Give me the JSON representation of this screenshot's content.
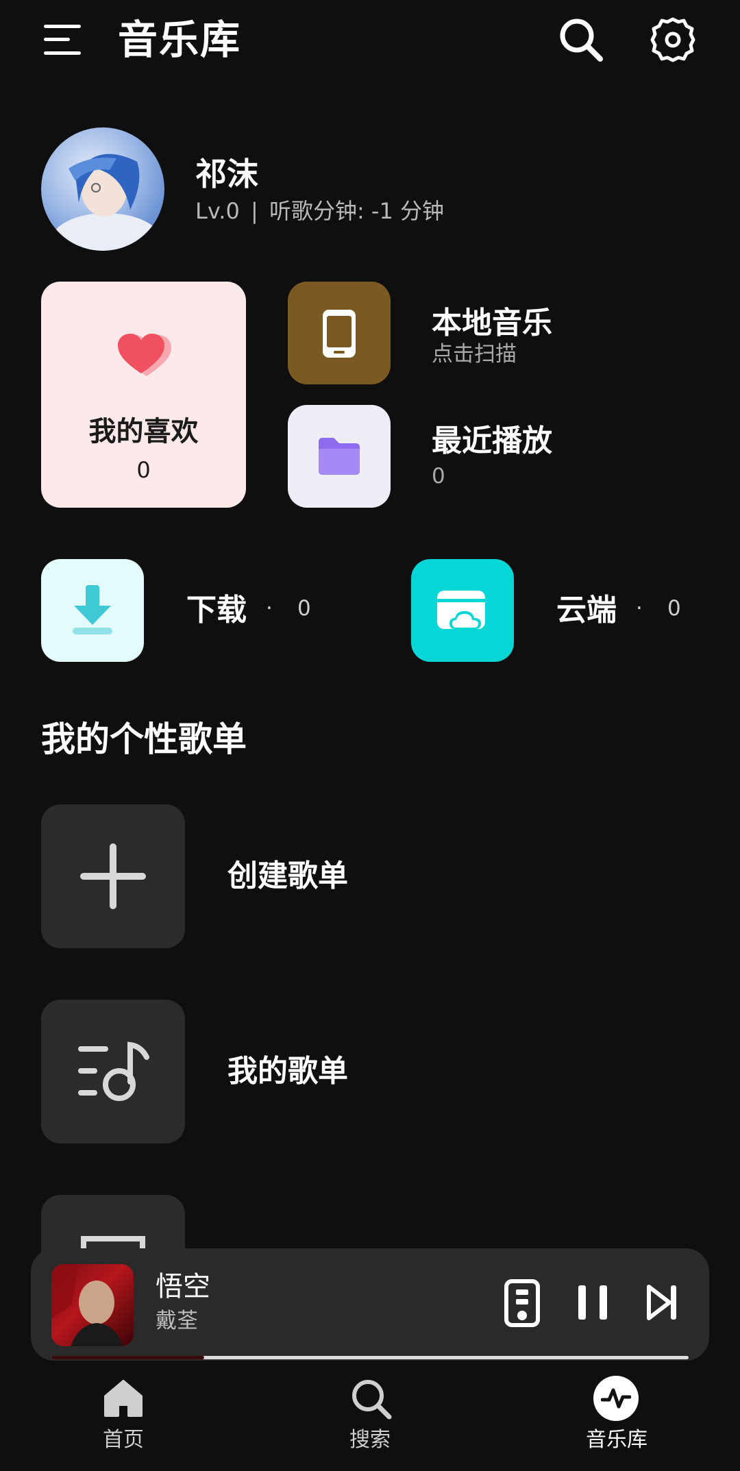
{
  "header": {
    "title": "音乐库",
    "menu_icon": "menu-icon",
    "search_icon": "search-icon",
    "settings_icon": "settings-gear-icon"
  },
  "profile": {
    "name": "祁沫",
    "level": "Lv.0",
    "separator": "|",
    "listen_label": "听歌分钟:",
    "listen_value": "-1 分钟"
  },
  "favorites": {
    "label": "我的喜欢",
    "count": "0",
    "icon": "heart-icon",
    "color": "#f0505f"
  },
  "local_music": {
    "title": "本地音乐",
    "subtitle": "点击扫描",
    "icon": "phone-icon",
    "color": "#7a5a22"
  },
  "recent": {
    "title": "最近播放",
    "count": "0",
    "icon": "folder-icon",
    "color": "#8e6cf0"
  },
  "downloads": {
    "label": "下载",
    "dot": "·",
    "count": "0",
    "icon": "download-icon"
  },
  "cloud": {
    "label": "云端",
    "dot": "·",
    "count": "0",
    "icon": "cloud-icon",
    "color": "#06d6d6"
  },
  "playlists": {
    "section_title": "我的个性歌单",
    "items": [
      {
        "label": "创建歌单",
        "icon": "plus-icon"
      },
      {
        "label": "我的歌单",
        "icon": "playlist-icon"
      }
    ]
  },
  "player": {
    "title": "悟空",
    "artist": "戴荃",
    "progress": 0.24,
    "device_icon": "speaker-icon",
    "pause_icon": "pause-icon",
    "next_icon": "skip-next-icon"
  },
  "nav": {
    "items": [
      {
        "label": "首页",
        "icon": "home-icon"
      },
      {
        "label": "搜索",
        "icon": "search-icon"
      },
      {
        "label": "音乐库",
        "icon": "activity-icon"
      }
    ]
  }
}
